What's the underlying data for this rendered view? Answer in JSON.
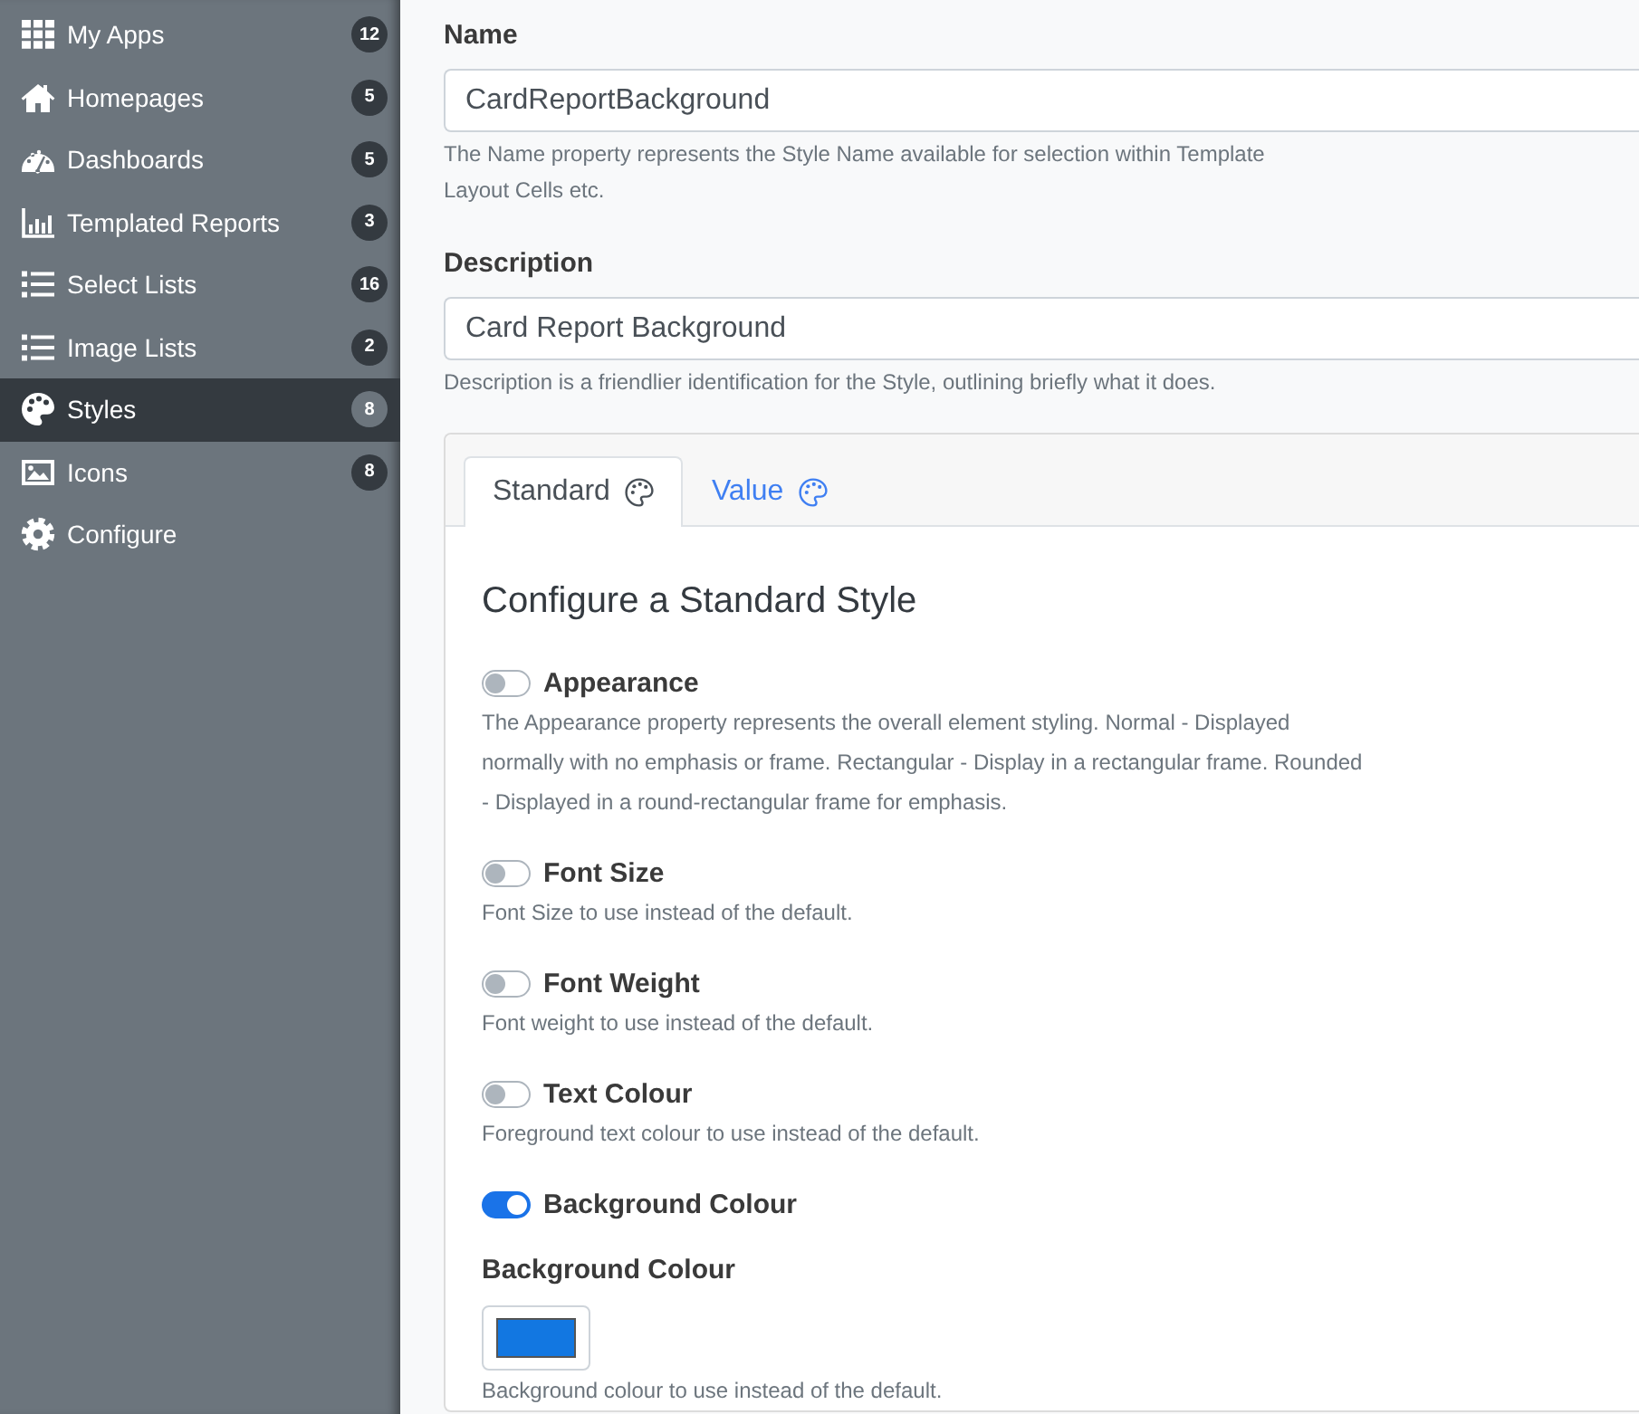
{
  "sidebar": {
    "items": [
      {
        "label": "My Apps",
        "count": "12",
        "selected": false
      },
      {
        "label": "Homepages",
        "count": "5",
        "selected": false
      },
      {
        "label": "Dashboards",
        "count": "5",
        "selected": false
      },
      {
        "label": "Templated Reports",
        "count": "3",
        "selected": false
      },
      {
        "label": "Select Lists",
        "count": "16",
        "selected": false
      },
      {
        "label": "Image Lists",
        "count": "2",
        "selected": false
      },
      {
        "label": "Styles",
        "count": "8",
        "selected": true
      },
      {
        "label": "Icons",
        "count": "8",
        "selected": false
      },
      {
        "label": "Configure",
        "selected": false
      }
    ]
  },
  "form": {
    "fields": [
      {
        "label": "Name",
        "value": "CardReportBackground",
        "help": "The Name property represents the Style Name available for selection within Template Layout Cells etc."
      },
      {
        "label": "Description",
        "value": "Card Report Background",
        "help": "Description is a friendlier identification for the Style, outlining briefly what it does."
      }
    ],
    "tabs": [
      {
        "label": "Standard",
        "selected": true
      },
      {
        "label": "Value",
        "selected": false
      }
    ],
    "section_title": "Configure a Standard Style",
    "options": [
      {
        "label": "Appearance",
        "on": false,
        "description": "The Appearance property represents the overall element styling. Normal - Displayed normally with no emphasis or frame. Rectangular - Display in a rectangular frame. Rounded - Displayed in a round-rectangular frame for emphasis."
      },
      {
        "label": "Font Size",
        "on": false,
        "description": "Font Size to use instead of the default."
      },
      {
        "label": "Font Weight",
        "on": false,
        "description": "Font weight to use instead of the default."
      },
      {
        "label": "Text Colour",
        "on": false,
        "description": "Foreground text colour to use instead of the default."
      },
      {
        "label": "Background Colour",
        "on": true
      }
    ],
    "colour_field": {
      "label": "Background Colour",
      "color": "#1277e1",
      "help": "Background colour to use instead of the default."
    }
  }
}
